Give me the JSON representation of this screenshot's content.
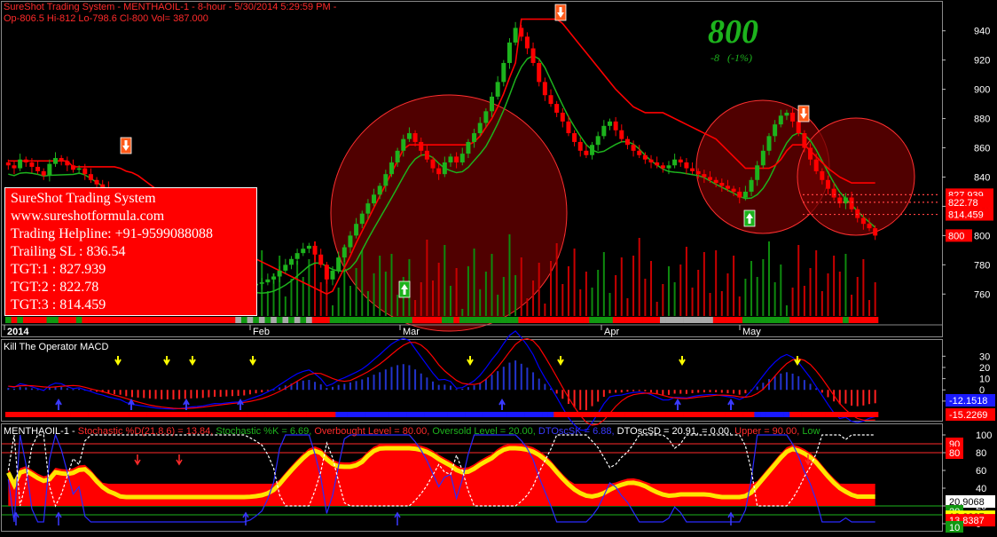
{
  "header": {
    "line1": "SureShot Trading System - MENTHAOIL-1 - 8-hour  - 5/30/2014 5:29:59 PM -",
    "line2": "Op-806.5  Hi-812  Lo-798.6  Cl-800  Vol=  387.000"
  },
  "price_display": {
    "last": "800",
    "change": "-8   (-1%)"
  },
  "info_box": {
    "lines": [
      "SureShot Trading System",
      "www.sureshotformula.com",
      "Trading Helpline: +91-9599088088",
      "Trailing SL : 836.54",
      "TGT:1 : 827.939",
      "TGT:2 : 822.78",
      "TGT:3 : 814.459"
    ]
  },
  "panel2": {
    "title": "Kill The Operator MACD",
    "badges": [
      "-12.1518",
      "-15.2269"
    ],
    "ticks": [
      "30",
      "20",
      "10",
      "0",
      "-10"
    ]
  },
  "panel3": {
    "symbol": "MENTHAOIL-1 - ",
    "items": [
      {
        "text": "Stochastic %D(21,8,6) = 13.84, ",
        "color": "#ff2a2a"
      },
      {
        "text": "Stochastic %K = 6.69, ",
        "color": "#1db31d"
      },
      {
        "text": "Overbought Level = 80.00, ",
        "color": "#ff2a2a"
      },
      {
        "text": "Oversold Level = 20.00, ",
        "color": "#1db31d"
      },
      {
        "text": "DTOscSK = 6.88, ",
        "color": "#3a3aff"
      },
      {
        "text": "DTOscSD = 20.91, ",
        "color": "#ffffff"
      },
      {
        "text": "           = 0.00, ",
        "color": "#ffffff"
      },
      {
        "text": "Upper = 90.00, ",
        "color": "#ff2a2a"
      },
      {
        "text": "Low",
        "color": "#1db31d"
      }
    ],
    "badges": [
      "90",
      "80",
      "20.9068",
      "20",
      "13.8387",
      "13.8387",
      "10"
    ],
    "ticks": [
      "100",
      "80",
      "60",
      "40",
      "20",
      "0"
    ]
  },
  "colors": {
    "bull": "#1db31d",
    "bear": "#ff0000",
    "trail": "#ff0000",
    "macd": "#0000ff",
    "signal": "#ff0000"
  },
  "chart_data": {
    "type": "candlestick",
    "symbol": "MENTHAOIL-1",
    "interval": "8-hour",
    "ylim": [
      745,
      955
    ],
    "y_ticks": [
      760,
      780,
      800,
      820,
      840,
      860,
      880,
      900,
      920,
      940
    ],
    "x_labels": [
      "2014",
      "Feb",
      "Mar",
      "Apr",
      "May"
    ],
    "close": [
      848,
      846,
      852,
      850,
      847,
      844,
      841,
      849,
      853,
      851,
      848,
      845,
      846,
      842,
      838,
      835,
      833,
      830,
      828,
      826,
      822,
      818,
      814,
      810,
      806,
      802,
      798,
      795,
      792,
      790,
      788,
      786,
      783,
      780,
      778,
      776,
      772,
      770,
      768,
      766,
      765,
      766,
      767,
      768,
      770,
      772,
      776,
      780,
      784,
      788,
      791,
      793,
      787,
      780,
      770,
      776,
      785,
      792,
      800,
      808,
      815,
      822,
      828,
      834,
      842,
      850,
      858,
      866,
      870,
      864,
      858,
      852,
      846,
      842,
      850,
      854,
      850,
      856,
      864,
      870,
      877,
      885,
      895,
      905,
      918,
      932,
      942,
      936,
      928,
      918,
      905,
      896,
      890,
      884,
      878,
      870,
      864,
      858,
      855,
      862,
      868,
      875,
      878,
      872,
      866,
      862,
      858,
      855,
      852,
      850,
      848,
      846,
      848,
      852,
      850,
      846,
      844,
      842,
      840,
      838,
      836,
      834,
      832,
      830,
      826,
      830,
      838,
      848,
      858,
      868,
      876,
      882,
      884,
      878,
      870,
      860,
      852,
      844,
      838,
      832,
      826,
      822,
      826,
      818,
      812,
      808,
      805,
      800
    ],
    "trailing_stop": [
      851,
      851,
      851,
      851,
      851,
      851,
      851,
      851,
      851,
      851,
      851,
      847,
      847,
      847,
      847,
      847,
      847,
      847,
      847,
      846,
      844,
      843,
      841,
      838,
      835,
      832,
      829,
      826,
      822,
      819,
      816,
      813,
      810,
      806,
      803,
      800,
      797,
      794,
      792,
      790,
      788,
      786,
      784,
      782,
      780,
      778,
      776,
      774,
      772,
      770,
      768,
      766,
      764,
      762,
      760,
      762,
      770,
      778,
      786,
      795,
      803,
      811,
      819,
      827,
      835,
      843,
      851,
      859,
      862,
      862,
      862,
      862,
      862,
      862,
      862,
      862,
      862,
      862,
      862,
      864,
      868,
      874,
      880,
      888,
      897,
      908,
      918,
      948,
      948,
      948,
      948,
      948,
      948,
      948,
      945,
      940,
      935,
      930,
      925,
      920,
      915,
      910,
      905,
      900,
      896,
      892,
      888,
      886,
      884,
      884,
      884,
      884,
      882,
      880,
      878,
      876,
      874,
      872,
      870,
      868,
      866,
      862,
      858,
      854,
      850,
      846,
      846,
      846,
      846,
      846,
      848,
      852,
      858,
      862,
      862,
      862,
      858,
      854,
      850,
      846,
      843,
      840,
      838,
      836,
      836,
      836,
      836,
      836
    ],
    "targets": {
      "trailing_sl": 836.54,
      "tgt1": 827.939,
      "tgt2": 822.78,
      "tgt3": 814.459,
      "last": 800
    },
    "macd_ylim": [
      -18,
      35
    ],
    "stoch_ylim": [
      0,
      105
    ],
    "levels": {
      "overbought": 80,
      "oversold": 20,
      "upper": 90,
      "lower": 10
    }
  }
}
